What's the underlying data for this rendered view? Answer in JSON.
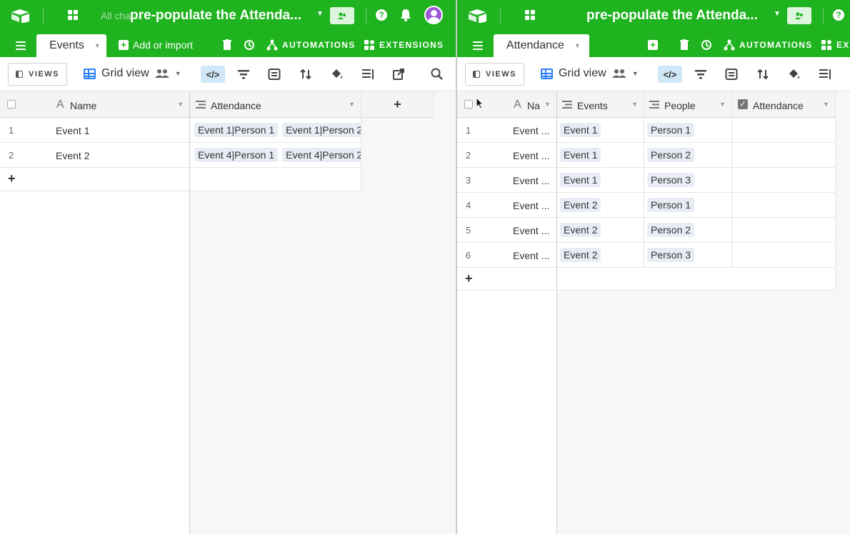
{
  "left": {
    "base_title": "pre-populate the Attenda...",
    "faded_text": "All cha",
    "active_tab": "Events",
    "add_import": "Add or import",
    "automations": "AUTOMATIONS",
    "extensions": "EXTENSIONS",
    "views": "VIEWS",
    "grid_view": "Grid view",
    "columns": [
      "Name",
      "Attendance"
    ],
    "rows": [
      {
        "num": "1",
        "name": "Event 1",
        "attendance": [
          "Event 1|Person 1",
          "Event 1|Person 2"
        ]
      },
      {
        "num": "2",
        "name": "Event 2",
        "attendance": [
          "Event 4|Person 1",
          "Event 4|Person 2"
        ]
      }
    ],
    "add_row": "+",
    "add_field": "+"
  },
  "right": {
    "base_title": "pre-populate the Attenda...",
    "active_tab": "Attendance",
    "automations": "AUTOMATIONS",
    "extensions": "EXTE",
    "views": "VIEWS",
    "grid_view": "Grid view",
    "columns": [
      "Na",
      "Events",
      "People",
      "Attendance"
    ],
    "rows": [
      {
        "num": "1",
        "name": "Event ...",
        "event": "Event 1",
        "person": "Person 1"
      },
      {
        "num": "2",
        "name": "Event ...",
        "event": "Event 1",
        "person": "Person 2"
      },
      {
        "num": "3",
        "name": "Event ...",
        "event": "Event 1",
        "person": "Person 3"
      },
      {
        "num": "4",
        "name": "Event ...",
        "event": "Event 2",
        "person": "Person 1"
      },
      {
        "num": "5",
        "name": "Event ...",
        "event": "Event 2",
        "person": "Person 2"
      },
      {
        "num": "6",
        "name": "Event ...",
        "event": "Event 2",
        "person": "Person 3"
      }
    ],
    "add_row": "+"
  },
  "colors": {
    "brand_green": "#1fb31f",
    "accent_blue": "#2d7ff9",
    "chip_bg": "#e8edf5",
    "avatar": "#9b59d6"
  },
  "icons": [
    "airtable-logo-icon",
    "apps-icon",
    "share-icon",
    "help-icon",
    "bell-icon",
    "avatar",
    "menu-icon",
    "trash-icon",
    "history-icon",
    "automations-icon",
    "extensions-icon",
    "grid-view-icon",
    "collaborators-icon",
    "hide-fields-icon",
    "filter-icon",
    "group-icon",
    "sort-icon",
    "color-icon",
    "row-height-icon",
    "share-view-icon",
    "search-icon",
    "text-field-icon",
    "link-field-icon",
    "checkbox-field-icon",
    "cursor-icon"
  ]
}
